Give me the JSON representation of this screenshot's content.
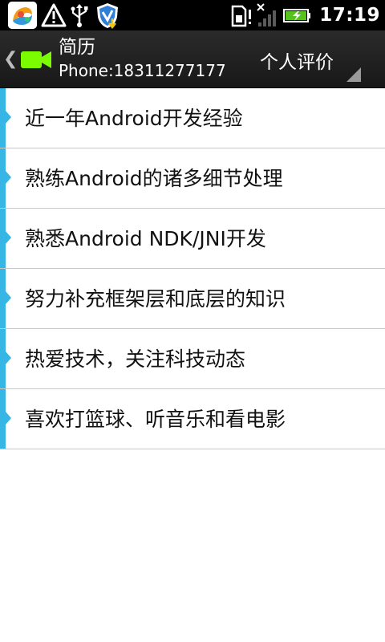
{
  "status_bar": {
    "time": "17:19",
    "icons": [
      "app-icon",
      "warning-icon",
      "usb-icon",
      "shield-download-icon",
      "sim-alert-icon",
      "signal-off-icon",
      "battery-charging-icon"
    ]
  },
  "action_bar": {
    "title": "简历",
    "subtitle": "Phone:18311277177",
    "spinner_selected": "个人评价",
    "icons": [
      "back-chevron-icon",
      "video-camera-icon"
    ]
  },
  "list": {
    "items": [
      {
        "label": "近一年Android开发经验"
      },
      {
        "label": "熟练Android的诸多细节处理"
      },
      {
        "label": "熟悉Android NDK/JNI开发"
      },
      {
        "label": "努力补充框架层和底层的知识"
      },
      {
        "label": "热爱技术，关注科技动态"
      },
      {
        "label": "喜欢打篮球、听音乐和看电影"
      }
    ]
  },
  "colors": {
    "accent": "#35b6e5",
    "video_icon": "#7cfc00",
    "status_bar": "#000000",
    "action_bar": "#222222"
  }
}
